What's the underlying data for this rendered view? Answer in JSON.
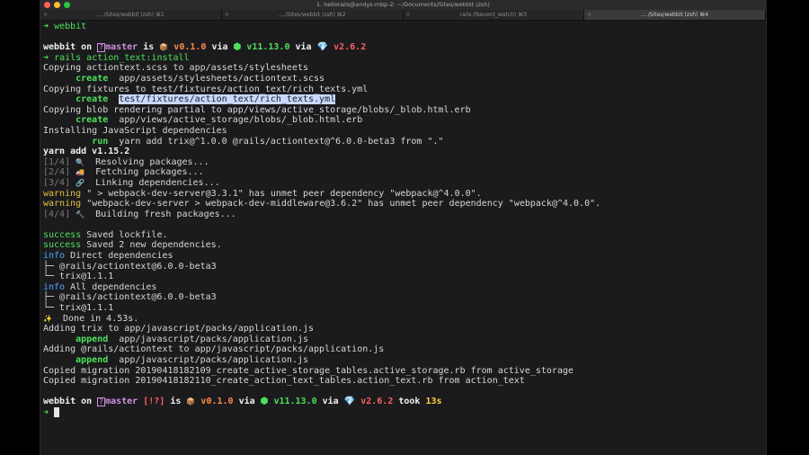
{
  "window": {
    "title": "1. hellorails@andys-mbp-2: ~/Documents/Sites/webbit (zsh)"
  },
  "tabs": [
    {
      "label": "..../Sites/webbit (zsh)",
      "shortcut": "⌘1"
    },
    {
      "label": "..../Sites/webbit (zsh)",
      "shortcut": "⌘2"
    },
    {
      "label": "rails (fsevent_watch)",
      "shortcut": "⌘3"
    },
    {
      "label": "..../Sites/webbit (zsh)",
      "shortcut": "⌘4"
    }
  ],
  "prompt": {
    "arrow": "➜",
    "dir": "webbit",
    "on": "on",
    "branch": "master",
    "is": "is",
    "pkg_version": "v0.1.0",
    "via": "via",
    "node_version": "v11.13.0",
    "ruby_version": "v2.6.2",
    "status": "[!?]",
    "took": "took",
    "duration": "13s"
  },
  "output": {
    "cmd": "rails action_text:install",
    "l1": "Copying actiontext.scss to app/assets/stylesheets",
    "l2_action": "create",
    "l2_path": "app/assets/stylesheets/actiontext.scss",
    "l3": "Copying fixtures to test/fixtures/action_text/rich_texts.yml",
    "l4_action": "create",
    "l4_path": "test/fixtures/action_text/rich_texts.yml",
    "l5": "Copying blob rendering partial to app/views/active_storage/blobs/_blob.html.erb",
    "l6_action": "create",
    "l6_path": "app/views/active_storage/blobs/_blob.html.erb",
    "l7": "Installing JavaScript dependencies",
    "l8_action": "run",
    "l8_text": "yarn add trix@^1.0.0 @rails/actiontext@^6.0.0-beta3 from \".\"",
    "l9": "yarn add v1.15.2",
    "s1_step": "[1/4]",
    "s1_text": "Resolving packages...",
    "s2_step": "[2/4]",
    "s2_text": "Fetching packages...",
    "s3_step": "[3/4]",
    "s3_text": "Linking dependencies...",
    "w1_label": "warning",
    "w1_text": "\" > webpack-dev-server@3.3.1\" has unmet peer dependency \"webpack@^4.0.0\".",
    "w2_label": "warning",
    "w2_text": "\"webpack-dev-server > webpack-dev-middleware@3.6.2\" has unmet peer dependency \"webpack@^4.0.0\".",
    "s4_step": "[4/4]",
    "s4_text": "Building fresh packages...",
    "ok1_label": "success",
    "ok1_text": "Saved lockfile.",
    "ok2_label": "success",
    "ok2_text": "Saved 2 new dependencies.",
    "i1_label": "info",
    "i1_text": "Direct dependencies",
    "t1": "├─ @rails/actiontext@6.0.0-beta3",
    "t2": "└─ trix@1.1.1",
    "i2_label": "info",
    "i2_text": "All dependencies",
    "t3": "├─ @rails/actiontext@6.0.0-beta3",
    "t4": "└─ trix@1.1.1",
    "done": "Done in 4.53s.",
    "a1": "Adding trix to app/javascript/packs/application.js",
    "a1b_action": "append",
    "a1b_path": "app/javascript/packs/application.js",
    "a2": "Adding @rails/actiontext to app/javascript/packs/application.js",
    "a2b_action": "append",
    "a2b_path": "app/javascript/packs/application.js",
    "m1": "Copied migration 20190418182109_create_active_storage_tables.active_storage.rb from active_storage",
    "m2": "Copied migration 20190418182110_create_action_text_tables.action_text.rb from action_text"
  },
  "icons": {
    "package": "package-icon",
    "node": "hexagon-icon",
    "ruby": "gem-icon",
    "resolve": "magnifier-icon",
    "fetch": "truck-icon",
    "link": "link-icon",
    "build": "hammer-icon",
    "done": "sparkles-icon"
  },
  "colors": {
    "green": "#4de05a",
    "purple": "#d08ee0",
    "red": "#ff5f5f",
    "orange": "#ff8a4a",
    "yellow": "#ffd33d",
    "blue": "#4fa3ff",
    "selection": "#c8d8ff"
  }
}
